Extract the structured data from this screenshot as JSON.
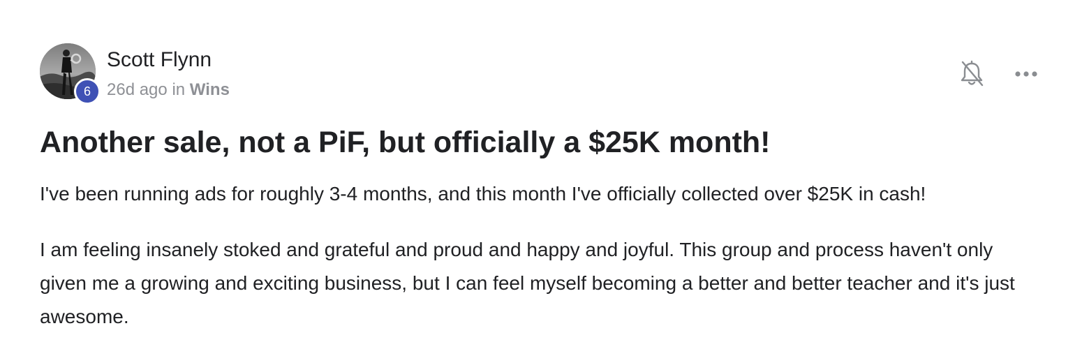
{
  "post": {
    "author": {
      "name": "Scott Flynn",
      "level": "6",
      "avatar_icon": "user-photo-avatar"
    },
    "meta": {
      "time": "26d ago",
      "in_word": "in",
      "category": "Wins"
    },
    "actions": {
      "notify_icon": "bell-off-icon",
      "more_icon": "more-horizontal-icon"
    },
    "title": "Another sale, not a PiF, but officially a $25K month!",
    "body": [
      "I've been running ads for roughly 3-4 months, and this month I've officially collected over $25K in cash!",
      "I am feeling insanely stoked and grateful and proud and happy and joyful. This group and process haven't only given me a growing and exciting business, but I can feel myself becoming a better and better teacher and it's just awesome."
    ]
  },
  "colors": {
    "level_badge": "#3f51b5",
    "meta_text": "#8e9095",
    "body_text": "#202124"
  }
}
